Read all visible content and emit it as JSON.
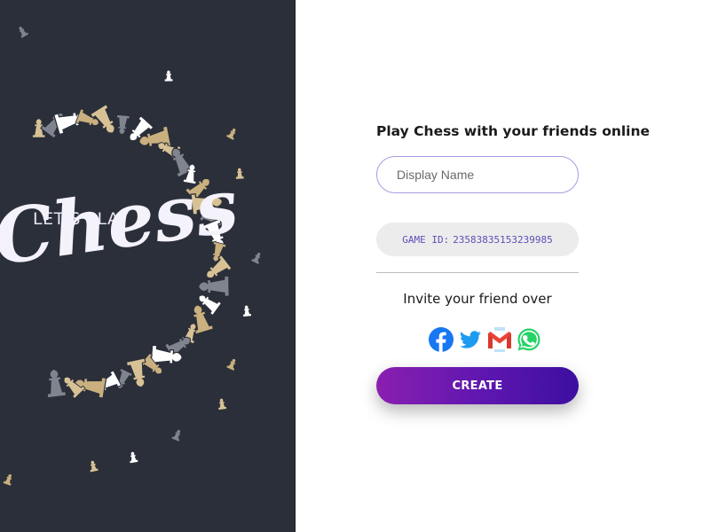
{
  "hero": {
    "tagline": "LET'S PLAY",
    "script_word": "Chess",
    "background_color": "#2b2f3a",
    "piece_colors": [
      "#d8c295",
      "#7f848f",
      "#ffffff",
      "#c9b07e"
    ]
  },
  "form": {
    "title": "Play Chess with your friends online",
    "name_input": {
      "value": "",
      "placeholder": "Display Name"
    },
    "game_id": {
      "label": "GAME ID:",
      "value": "23583835153239985"
    },
    "invite_label": "Invite your friend over",
    "share_buttons": [
      {
        "icon": "facebook-icon",
        "color": "#1877f2"
      },
      {
        "icon": "twitter-icon",
        "color": "#1d9bf0"
      },
      {
        "icon": "gmail-icon",
        "color": "#ea4335"
      },
      {
        "icon": "whatsapp-icon",
        "color": "#25d366"
      }
    ],
    "create_button": "CREATE",
    "accent_color": "#5d16b0"
  }
}
